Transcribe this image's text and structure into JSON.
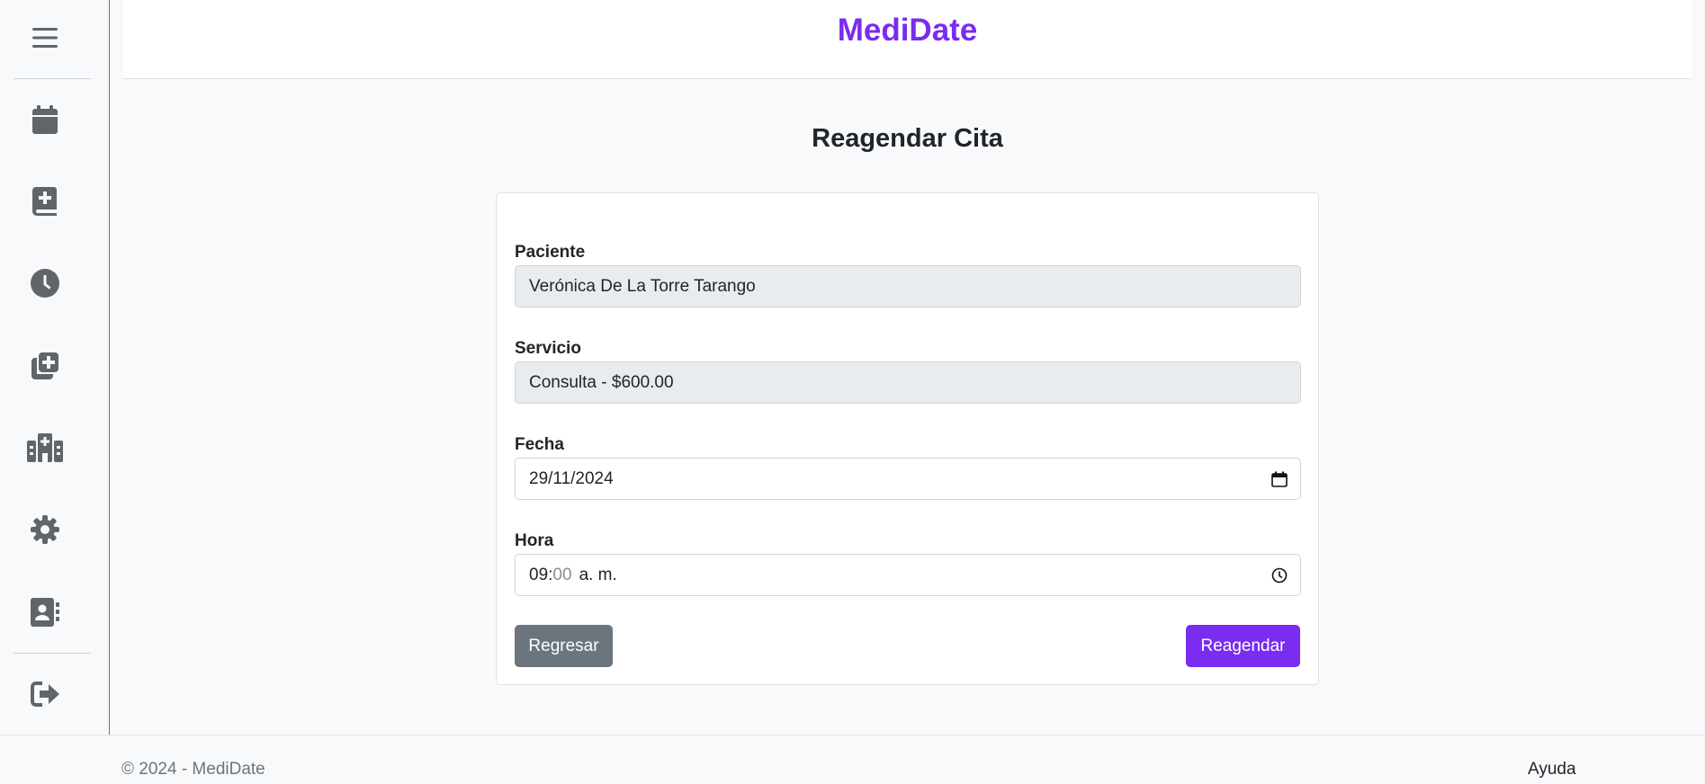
{
  "header": {
    "brand": "MediDate"
  },
  "sidebar": {
    "items": [
      {
        "icon": "menu-icon"
      },
      {
        "icon": "calendar-icon"
      },
      {
        "icon": "medical-book-icon"
      },
      {
        "icon": "clock-icon"
      },
      {
        "icon": "add-records-icon"
      },
      {
        "icon": "hospital-icon"
      },
      {
        "icon": "gear-icon"
      },
      {
        "icon": "contact-book-icon"
      },
      {
        "icon": "logout-icon"
      }
    ]
  },
  "main": {
    "title": "Reagendar Cita",
    "form": {
      "paciente_label": "Paciente",
      "paciente_value": "Verónica De La Torre Tarango",
      "servicio_label": "Servicio",
      "servicio_value": "Consulta - $600.00",
      "fecha_label": "Fecha",
      "fecha_value": "29/11/2024",
      "hora_label": "Hora",
      "hora_hour": "09:",
      "hora_minutes": "00",
      "hora_period": "a. m.",
      "back_label": "Regresar",
      "submit_label": "Reagendar"
    }
  },
  "footer": {
    "copyright": "© 2024 - MediDate",
    "help_label": "Ayuda"
  },
  "colors": {
    "brand": "#7a2cf0",
    "secondary": "#6c757d"
  }
}
